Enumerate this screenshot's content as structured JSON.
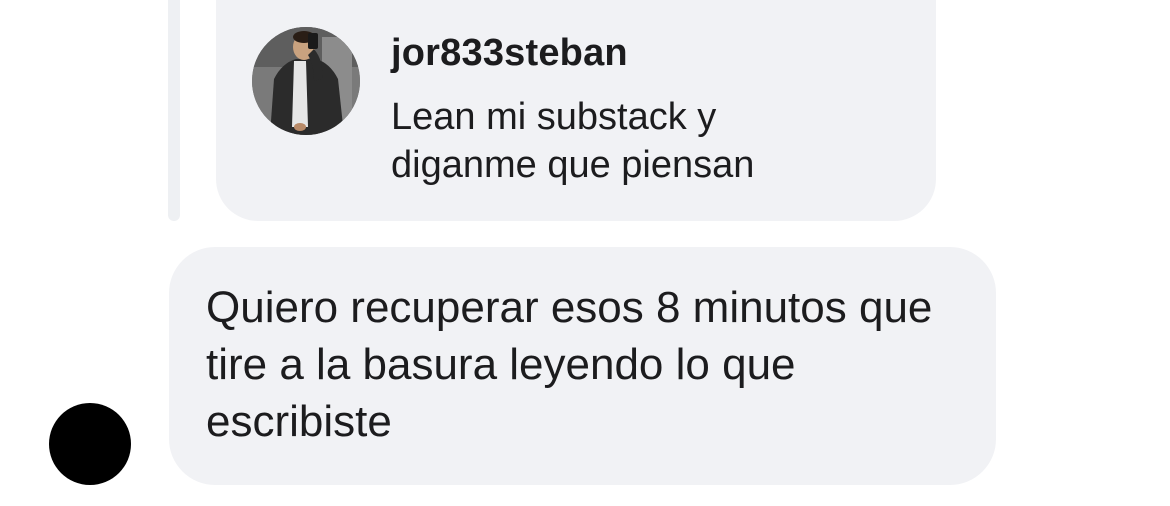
{
  "quoted_message": {
    "username": "jor833steban",
    "text": "Lean mi substack y diganme que piensan",
    "avatar_icon": "profile-photo"
  },
  "reply_message": {
    "text": "Quiero recuperar esos 8 minutos que tire a la basura leyendo lo que escribiste",
    "sender_avatar_color": "#000000"
  },
  "colors": {
    "bubble_background": "#f1f2f5",
    "text": "#1c1c1e"
  }
}
